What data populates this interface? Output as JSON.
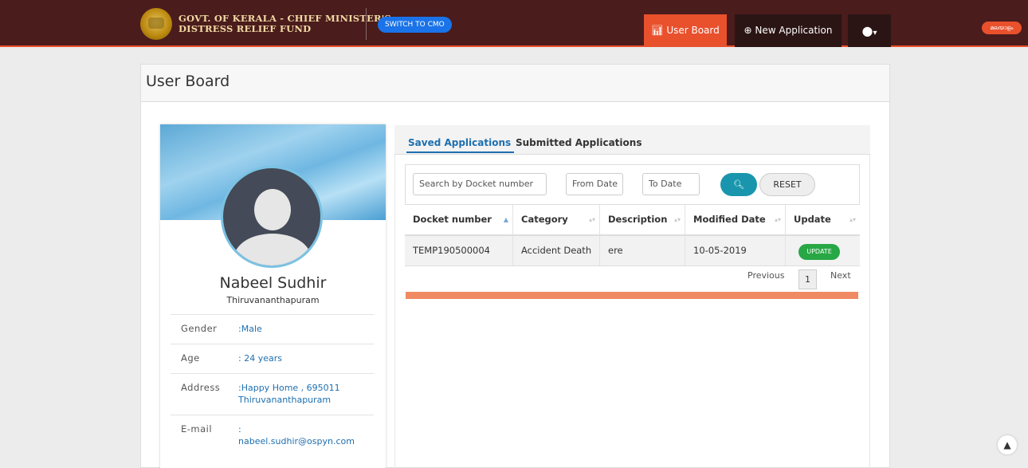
{
  "header": {
    "brand_line1": "GOVT. OF KERALA - CHIEF MINISTER'S",
    "brand_line2": "DISTRESS RELIEF FUND",
    "switch_label": "SWITCH TO CMO",
    "nav_userboard": "User Board",
    "nav_newapp": "New Application",
    "lang_label": "മലയാളം"
  },
  "page": {
    "title": "User Board"
  },
  "profile": {
    "name": "Nabeel Sudhir",
    "place": "Thiruvananthapuram",
    "fields": [
      {
        "label": "Gender",
        "value": ":Male"
      },
      {
        "label": "Age",
        "value": ": 24  years"
      },
      {
        "label": "Address",
        "value": ":Happy Home , 695011 Thiruvananthapuram"
      },
      {
        "label": "E-mail",
        "value": ": nabeel.sudhir@ospyn.com"
      }
    ]
  },
  "tabs": {
    "saved": "Saved Applications",
    "submitted": "Submitted Applications"
  },
  "search": {
    "docket_placeholder": "Search by Docket number",
    "from_placeholder": "From Date",
    "to_placeholder": "To Date",
    "reset_label": "RESET"
  },
  "table": {
    "headers": [
      "Docket number",
      "Category",
      "Description",
      "Modified Date",
      "Update"
    ],
    "rows": [
      {
        "docket": "TEMP190500004",
        "category": "Accident Death",
        "description": "ere",
        "date": "10-05-2019",
        "update": "UPDATE"
      }
    ]
  },
  "pagination": {
    "previous": "Previous",
    "page": "1",
    "next": "Next"
  },
  "colors": {
    "navbar": "#4a1c1c",
    "accent": "#e9502c",
    "link": "#1e6fb0",
    "update": "#28a745"
  },
  "icons": {
    "nav_userboard": "bar-chart-icon",
    "nav_newapp": "plus-circle-icon",
    "nav_user": "user-circle-icon",
    "search": "search-icon",
    "scroll_top": "chevron-up-icon"
  }
}
